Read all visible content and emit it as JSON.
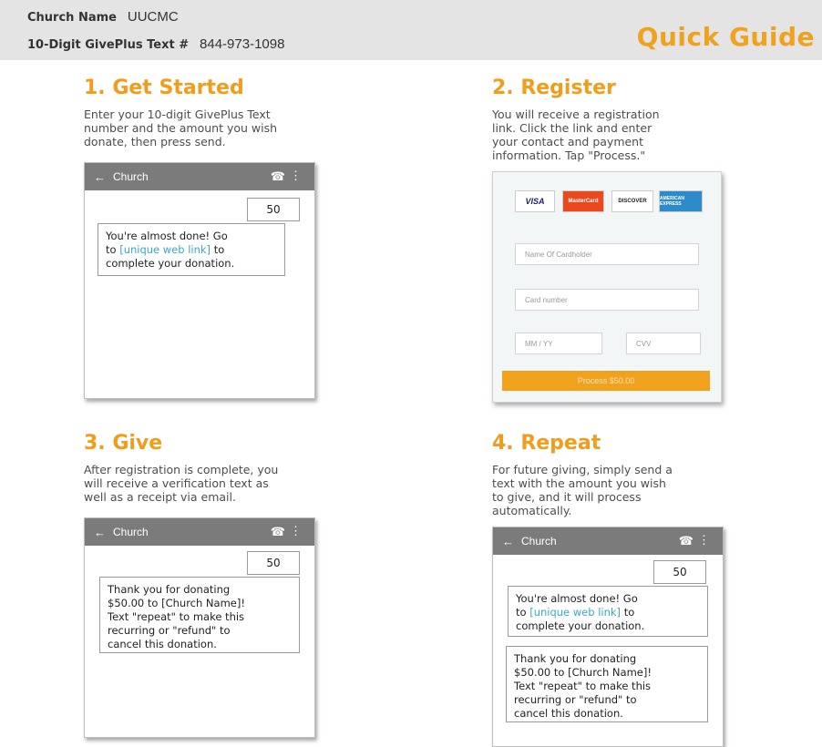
{
  "header": {
    "church_label": "Church Name",
    "church_value": "UUCMC",
    "text_label": "10-Digit GivePlus Text #",
    "text_value": "844-973-1098",
    "guide_title": "Quick Guide"
  },
  "steps": [
    {
      "title": "1. Get Started",
      "desc": [
        "Enter your 10-digit GivePlus Text",
        "number and the amount you wish",
        "donate, then press send."
      ]
    },
    {
      "title": "2. Register",
      "desc": [
        "You will receive a registration",
        "link. Click the link and enter",
        "your contact and payment",
        "information. Tap \"Process.\""
      ]
    },
    {
      "title": "3. Give",
      "desc": [
        "After registration is complete, you",
        "will receive a verification text as",
        "well as a receipt via email."
      ]
    },
    {
      "title": "4. Repeat",
      "desc": [
        "For future giving, simply send a",
        "text with the amount you wish",
        "to give, and it will process",
        "automatically."
      ]
    }
  ],
  "phone": {
    "contact": "Church",
    "back_icon": "←",
    "call_icon": "☎",
    "menu_icon": "⋮",
    "amount": "50",
    "almost_done": {
      "line1": "You're almost done! Go",
      "line2_pre": "to ",
      "line2_link": "[unique web link]",
      "line2_post": " to",
      "line3": "complete your donation."
    },
    "thank_you": [
      "Thank you for donating",
      "$50.00 to [Church Name]!",
      "Text \"repeat\" to make this",
      "recurring or \"refund\" to",
      "cancel this donation."
    ]
  },
  "card_form": {
    "logos": [
      "VISA",
      "MasterCard",
      "DISCOVER",
      "AMERICAN EXPRESS"
    ],
    "name_placeholder": "Name Of Cardholder",
    "card_placeholder": "Card number",
    "expiry_placeholder": "MM / YY",
    "cvv_placeholder": "CVV",
    "process_label": "Process $50.00"
  },
  "colors": {
    "accent": "#f29c1b",
    "header_bg": "#e4e4e4",
    "phone_bar": "#7b7b7b",
    "link": "#3aa8c9"
  }
}
